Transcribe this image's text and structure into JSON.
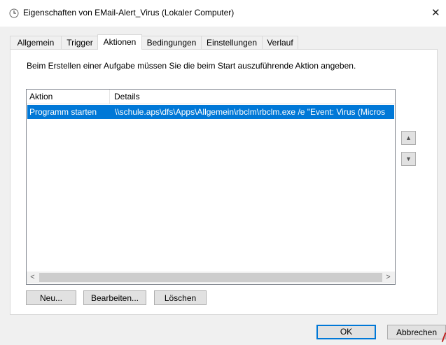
{
  "window": {
    "title": "Eigenschaften von EMail-Alert_Virus (Lokaler Computer)",
    "close_glyph": "✕"
  },
  "tabs": [
    {
      "label": "Allgemein"
    },
    {
      "label": "Trigger"
    },
    {
      "label": "Aktionen"
    },
    {
      "label": "Bedingungen"
    },
    {
      "label": "Einstellungen"
    },
    {
      "label": "Verlauf"
    }
  ],
  "panel": {
    "instruction": "Beim Erstellen einer Aufgabe müssen Sie die beim Start auszuführende Aktion angeben."
  },
  "actions_table": {
    "columns": [
      "Aktion",
      "Details"
    ],
    "rows": [
      {
        "action": "Programm starten",
        "details": "\\\\schule.aps\\dfs\\Apps\\Allgemein\\rbclm\\rbclm.exe /e \"Event: Virus (Micros"
      }
    ]
  },
  "scrollbar": {
    "left": "<",
    "right": ">"
  },
  "move_buttons": {
    "up": "▲",
    "down": "▼"
  },
  "buttons": {
    "new": "Neu...",
    "edit": "Bearbeiten...",
    "delete": "Löschen"
  },
  "footer": {
    "ok": "OK",
    "cancel": "Abbrechen"
  },
  "colors": {
    "selection": "#0078d7",
    "window_bg": "#f0f0f0"
  }
}
